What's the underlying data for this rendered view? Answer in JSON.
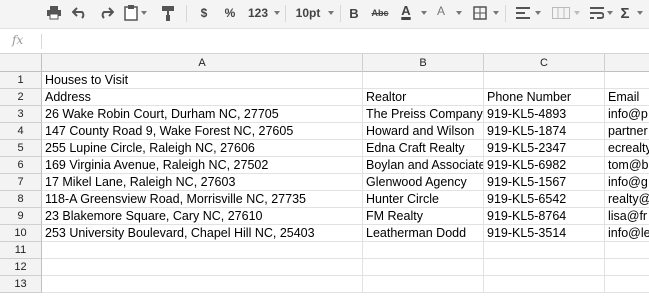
{
  "toolbar": {
    "print_icon": "printer-icon",
    "undo_icon": "undo-icon",
    "redo_icon": "redo-icon",
    "clipboard_icon": "clipboard-icon",
    "paint_format_icon": "paint-format-icon",
    "currency_label": "$",
    "percent_label": "%",
    "number_format_label": "123",
    "font_size_label": "10pt",
    "bold_label": "B",
    "strikethrough_label": "Abc",
    "text_color_label": "A",
    "fill_color_label": "A",
    "text_color": "#000000",
    "fill_color": "#ffffff",
    "borders_icon": "borders-icon",
    "align_icon": "align-left-icon",
    "merge_icon": "merge-cells-icon",
    "wrap_icon": "wrap-text-icon",
    "functions_label": "Σ"
  },
  "formula_bar": {
    "fx_label": "fx",
    "value": ""
  },
  "columns": [
    "A",
    "B",
    "C",
    ""
  ],
  "rows": [
    {
      "num": "1",
      "cells": [
        "Houses to Visit",
        "",
        "",
        ""
      ]
    },
    {
      "num": "2",
      "cells": [
        "Address",
        "Realtor",
        "Phone Number",
        "Email"
      ]
    },
    {
      "num": "3",
      "cells": [
        "26 Wake Robin Court, Durham NC, 27705",
        "The Preiss Company",
        "919-KL5-4893",
        "info@p"
      ]
    },
    {
      "num": "4",
      "cells": [
        "147 County Road 9, Wake Forest NC, 27605",
        "Howard and Wilson",
        "919-KL5-1874",
        "partner"
      ]
    },
    {
      "num": "5",
      "cells": [
        "255 Lupine Circle, Raleigh NC, 27606",
        "Edna Craft Realty",
        "919-KL5-2347",
        "ecrealty"
      ]
    },
    {
      "num": "6",
      "cells": [
        "169 Virginia Avenue, Raleigh NC, 27502",
        "Boylan and Associates",
        "919-KL5-6982",
        "tom@b"
      ]
    },
    {
      "num": "7",
      "cells": [
        "17 Mikel Lane, Raleigh NC, 27603",
        "Glenwood Agency",
        "919-KL5-1567",
        "info@g"
      ]
    },
    {
      "num": "8",
      "cells": [
        "118-A Greensview Road, Morrisville NC, 27735",
        "Hunter Circle",
        "919-KL5-6542",
        "realty@"
      ]
    },
    {
      "num": "9",
      "cells": [
        "23 Blakemore Square, Cary NC, 27610",
        "FM Realty",
        "919-KL5-8764",
        "lisa@fr"
      ]
    },
    {
      "num": "10",
      "cells": [
        "253 University Boulevard, Chapel Hill NC, 25403",
        "Leatherman Dodd",
        "919-KL5-3514",
        "info@le"
      ]
    },
    {
      "num": "11",
      "cells": [
        "",
        "",
        "",
        ""
      ]
    },
    {
      "num": "12",
      "cells": [
        "",
        "",
        "",
        ""
      ]
    },
    {
      "num": "13",
      "cells": [
        "",
        "",
        "",
        ""
      ]
    }
  ]
}
